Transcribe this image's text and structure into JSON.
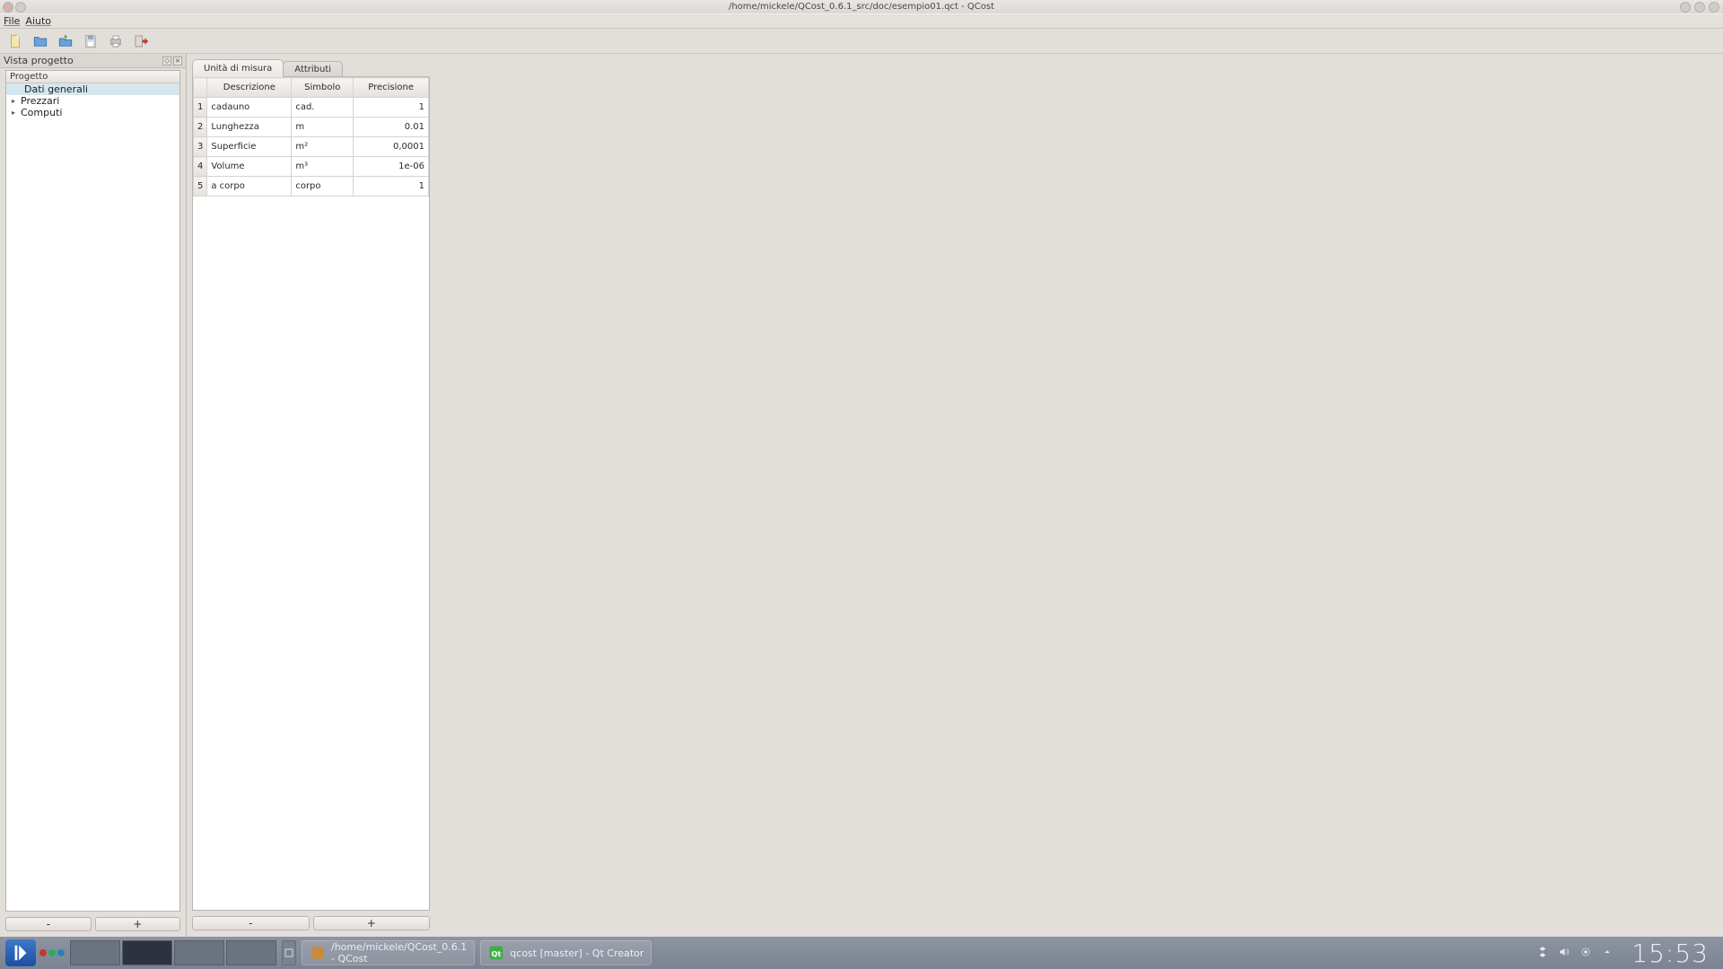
{
  "window": {
    "title": "/home/mickele/QCost_0.6.1_src/doc/esempio01.qct - QCost"
  },
  "menubar": {
    "file": "File",
    "help": "Aiuto"
  },
  "dock": {
    "title": "Vista progetto",
    "tree_header": "Progetto",
    "items": [
      "Dati generali",
      "Prezzari",
      "Computi"
    ],
    "minus": "-",
    "plus": "+"
  },
  "tabs": {
    "units": "Unità di misura",
    "attrs": "Attributi"
  },
  "table": {
    "headers": {
      "desc": "Descrizione",
      "sym": "Simbolo",
      "prec": "Precisione"
    },
    "rows": [
      {
        "n": "1",
        "desc": "cadauno",
        "sym": "cad.",
        "prec": "1"
      },
      {
        "n": "2",
        "desc": "Lunghezza",
        "sym": "m",
        "prec": "0.01"
      },
      {
        "n": "3",
        "desc": "Superficie",
        "sym": "m²",
        "prec": "0,0001"
      },
      {
        "n": "4",
        "desc": "Volume",
        "sym": "m³",
        "prec": "1e-06"
      },
      {
        "n": "5",
        "desc": "a corpo",
        "sym": "corpo",
        "prec": "1"
      }
    ],
    "minus": "-",
    "plus": "+"
  },
  "taskbar": {
    "entry1_line1": "/home/mickele/QCost_0.6.1",
    "entry1_line2": "- QCost",
    "entry2": "qcost [master] - Qt Creator",
    "clock": "15:53"
  }
}
